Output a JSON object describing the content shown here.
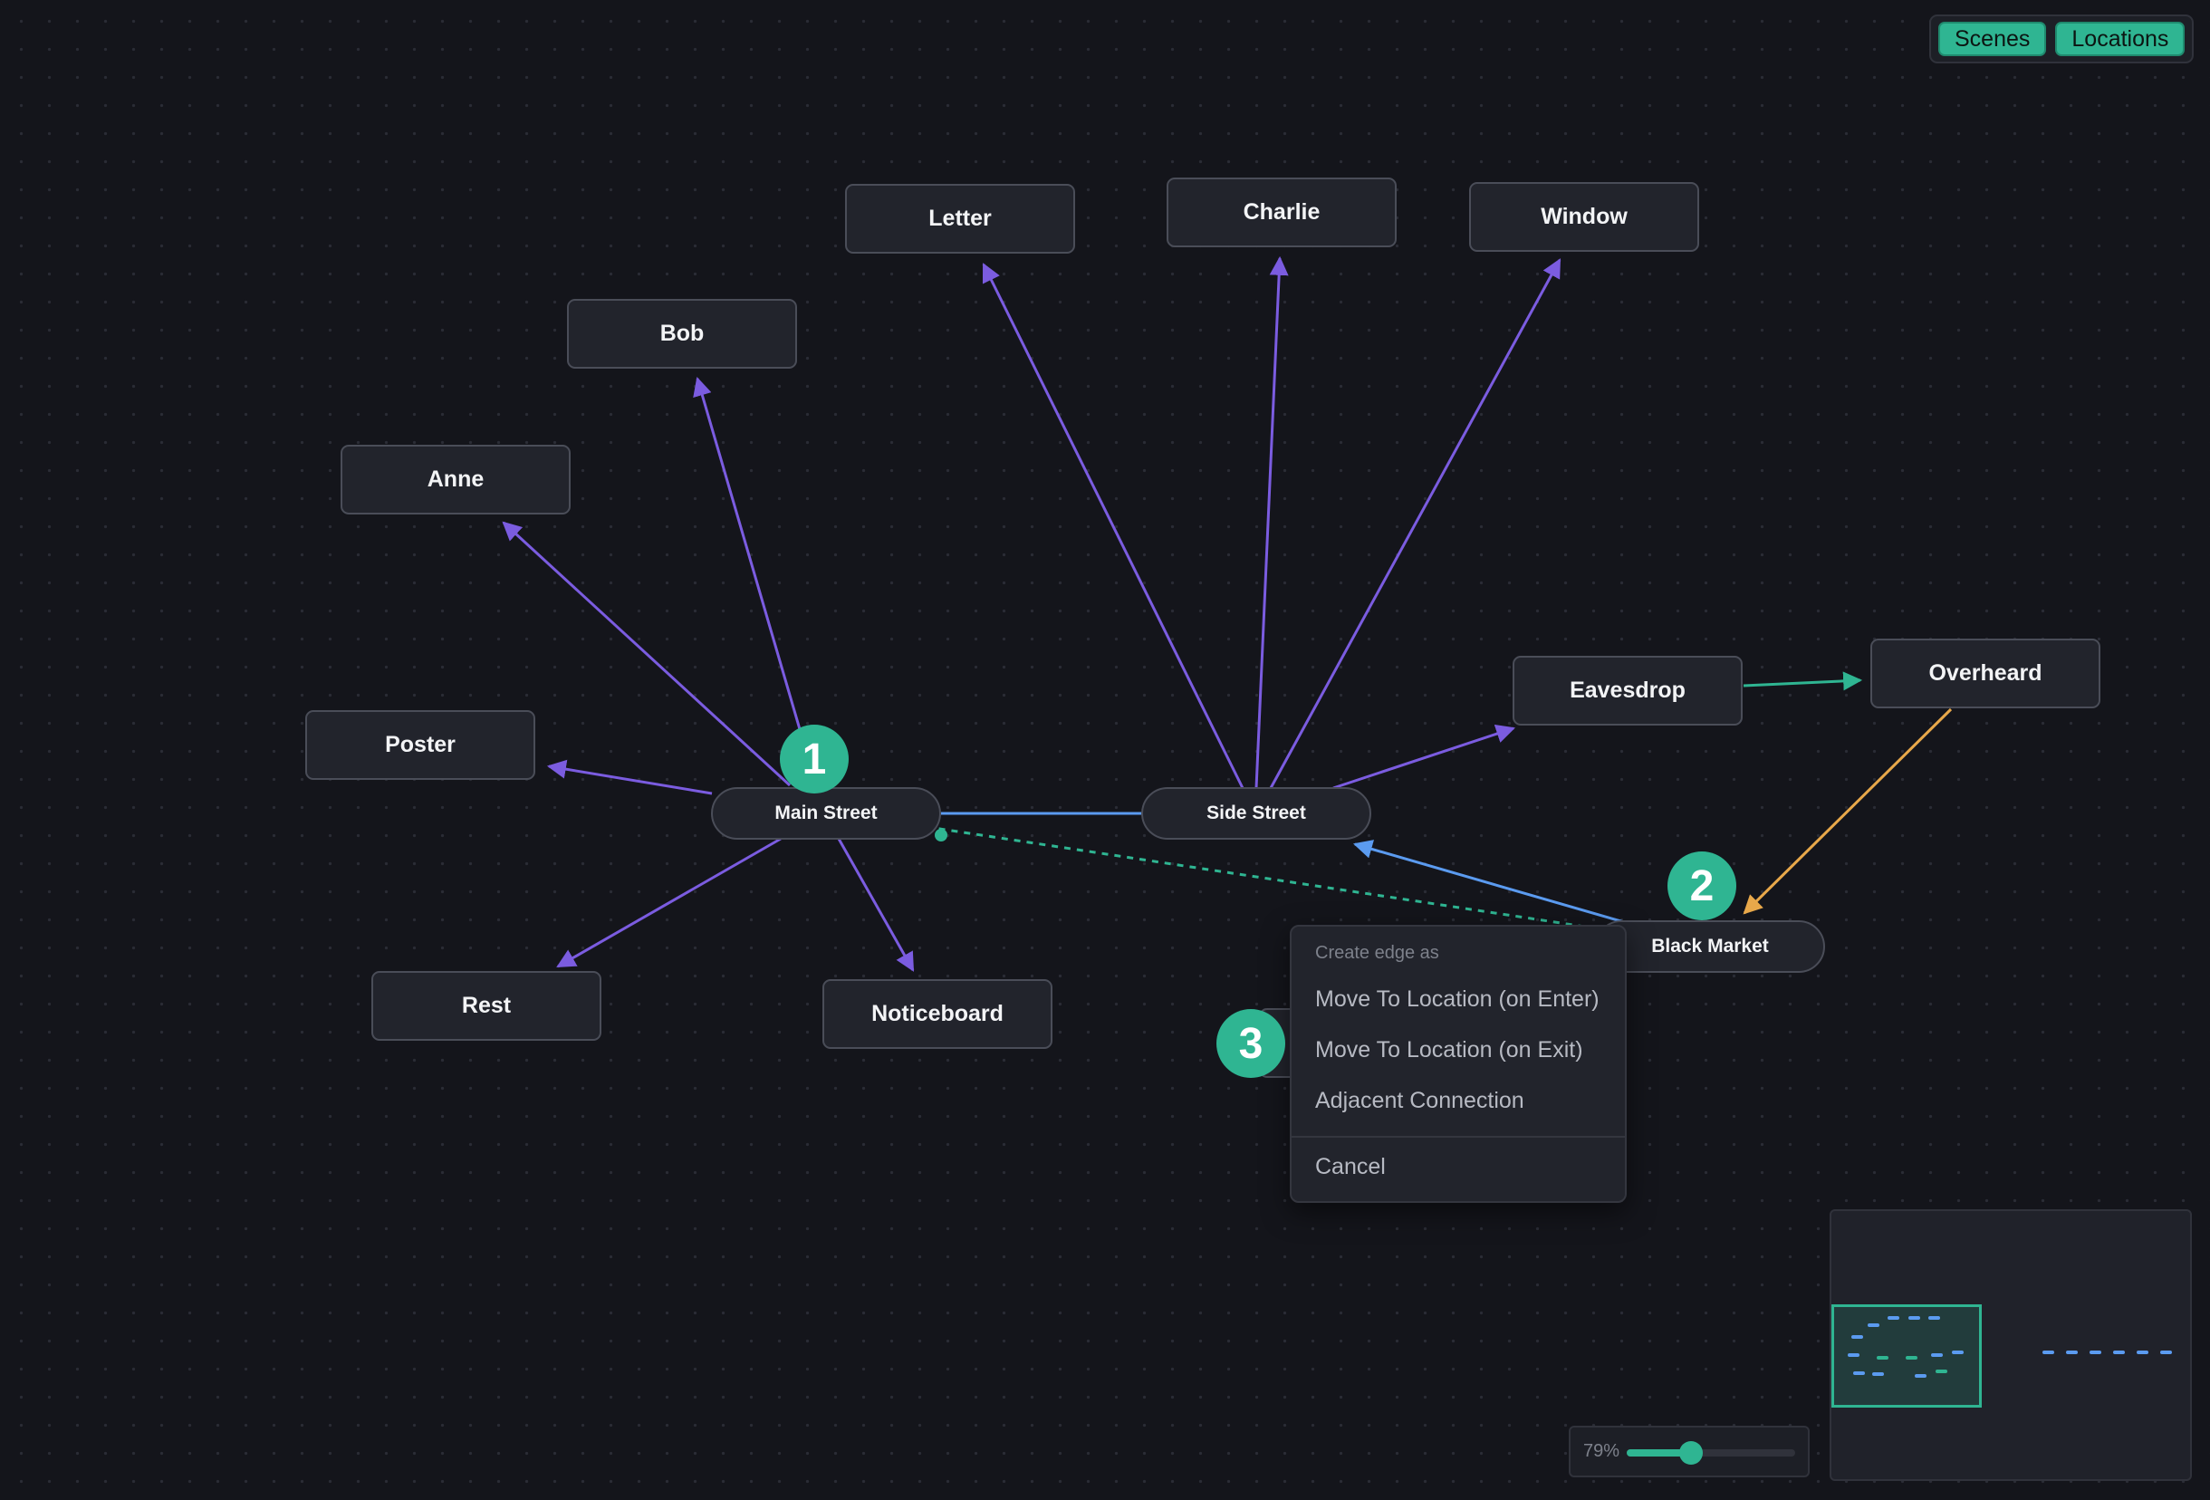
{
  "toolbar": {
    "scenes_label": "Scenes",
    "locations_label": "Locations"
  },
  "graph": {
    "scenes": {
      "letter": "Letter",
      "charlie": "Charlie",
      "window": "Window",
      "bob": "Bob",
      "anne": "Anne",
      "poster": "Poster",
      "eavesdrop": "Eavesdrop",
      "overheard": "Overheard",
      "rest": "Rest",
      "noticeboard": "Noticeboard"
    },
    "locations": {
      "main_street": "Main Street",
      "side_street": "Side Street",
      "black_market": "Black Market"
    }
  },
  "annotations": {
    "step1": "1",
    "step2": "2",
    "step3": "3"
  },
  "context_menu": {
    "heading": "Create edge as",
    "items": [
      "Move To Location (on Enter)",
      "Move To Location (on Exit)",
      "Adjacent Connection"
    ],
    "cancel": "Cancel"
  },
  "zoom": {
    "label": "79%",
    "value": 0.38
  },
  "colors": {
    "accent": "#2fb592",
    "scene_edge": "#7b5ce0",
    "location_edge": "#5b9bf0",
    "chain_edge": "#2fb592",
    "exit_edge": "#e8a84a",
    "pending_edge": "#2fb592"
  }
}
